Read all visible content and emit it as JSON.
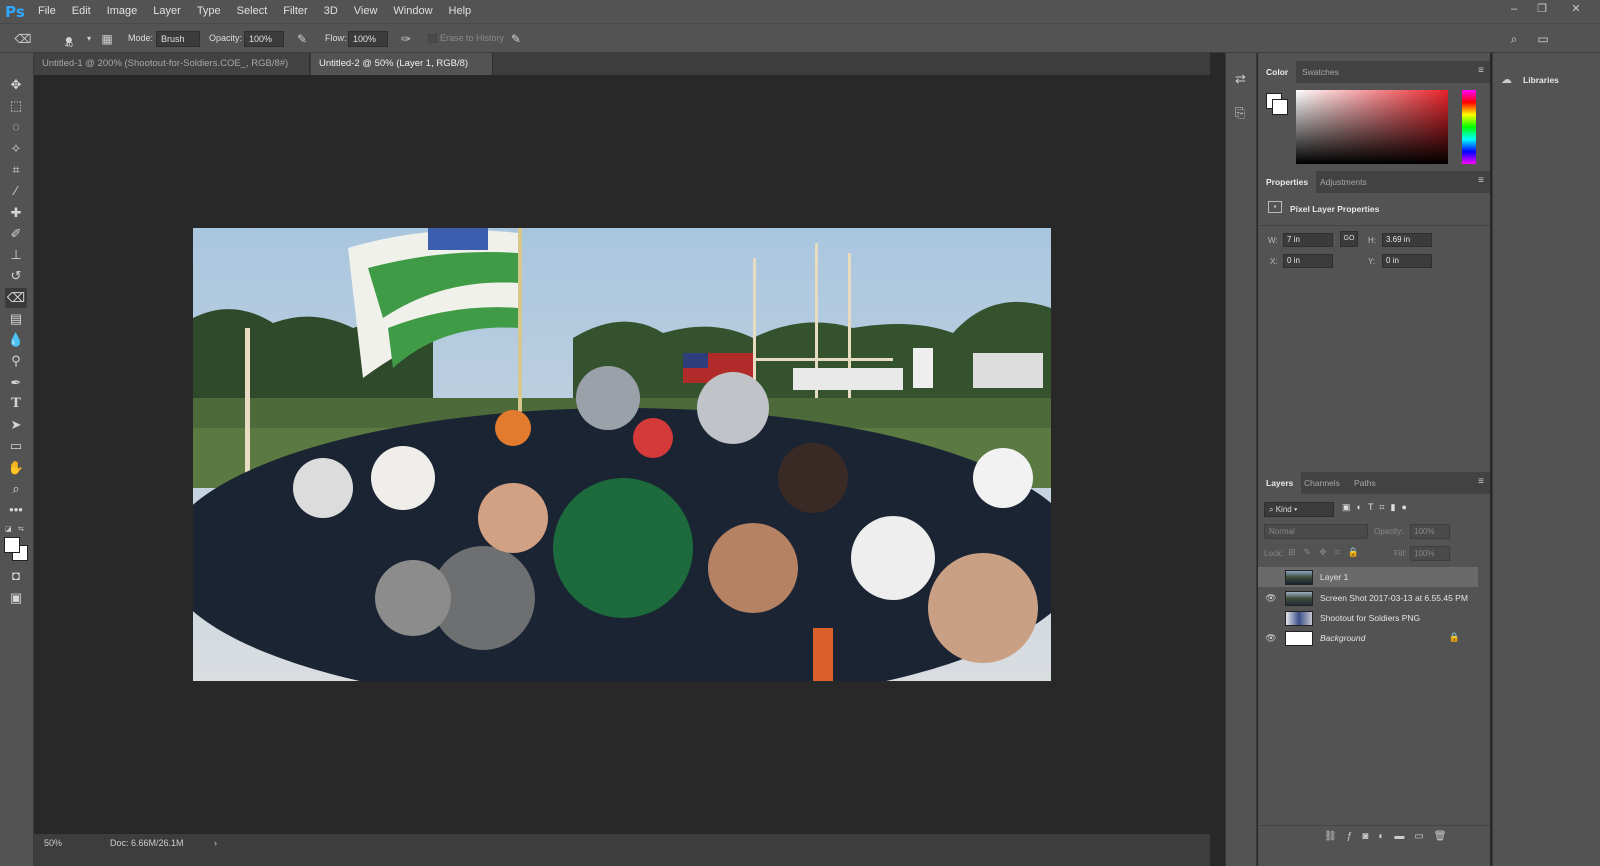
{
  "app": {
    "logo": "Ps"
  },
  "menu": [
    "File",
    "Edit",
    "Image",
    "Layer",
    "Type",
    "Select",
    "Filter",
    "3D",
    "View",
    "Window",
    "Help"
  ],
  "options_bar": {
    "brush_size": "40",
    "mode_label": "Mode:",
    "mode_value": "Brush",
    "opacity_label": "Opacity:",
    "opacity_value": "100%",
    "flow_label": "Flow:",
    "flow_value": "100%",
    "erase_to_history": "Erase to History"
  },
  "tabs": [
    {
      "label": "Untitled-1 @ 200% (Shootout-for-Soldiers.COE_, RGB/8#) *",
      "active": false
    },
    {
      "label": "Untitled-2 @ 50% (Layer 1, RGB/8) *",
      "active": true
    }
  ],
  "status": {
    "zoom": "50%",
    "doc": "Doc: 6.66M/26.1M",
    "arrow": "›"
  },
  "color_panel": {
    "tabs": [
      "Color",
      "Swatches"
    ],
    "active": "Color",
    "hue_color": "#e8232a"
  },
  "properties_panel": {
    "tabs": [
      "Properties",
      "Adjustments"
    ],
    "title": "Pixel Layer Properties",
    "w_label": "W:",
    "w_value": "7 in",
    "h_label": "H:",
    "h_value": "3.69 in",
    "x_label": "X:",
    "x_value": "0 in",
    "y_label": "Y:",
    "y_value": "0 in",
    "link_label": "GO"
  },
  "layers_panel": {
    "tabs": [
      "Layers",
      "Channels",
      "Paths"
    ],
    "filter_label": "Kind",
    "blend_mode": "Normal",
    "opacity_label": "Opacity:",
    "opacity_value": "100%",
    "lock_label": "Lock:",
    "fill_label": "Fill:",
    "fill_value": "100%",
    "layers": [
      {
        "name": "Layer 1",
        "visible": false,
        "selected": true,
        "italic": false
      },
      {
        "name": "Screen Shot 2017-03-13 at 6.55.45 PM",
        "visible": true,
        "selected": false,
        "italic": false
      },
      {
        "name": "Shootout for Soldiers PNG",
        "visible": false,
        "selected": false,
        "italic": false
      },
      {
        "name": "Background",
        "visible": true,
        "selected": false,
        "italic": true,
        "locked": true
      }
    ]
  },
  "libraries": {
    "label": "Libraries"
  },
  "colors": {
    "accent": "#31a8ff",
    "panel_bg": "#535353",
    "canvas_bg": "#282828"
  }
}
